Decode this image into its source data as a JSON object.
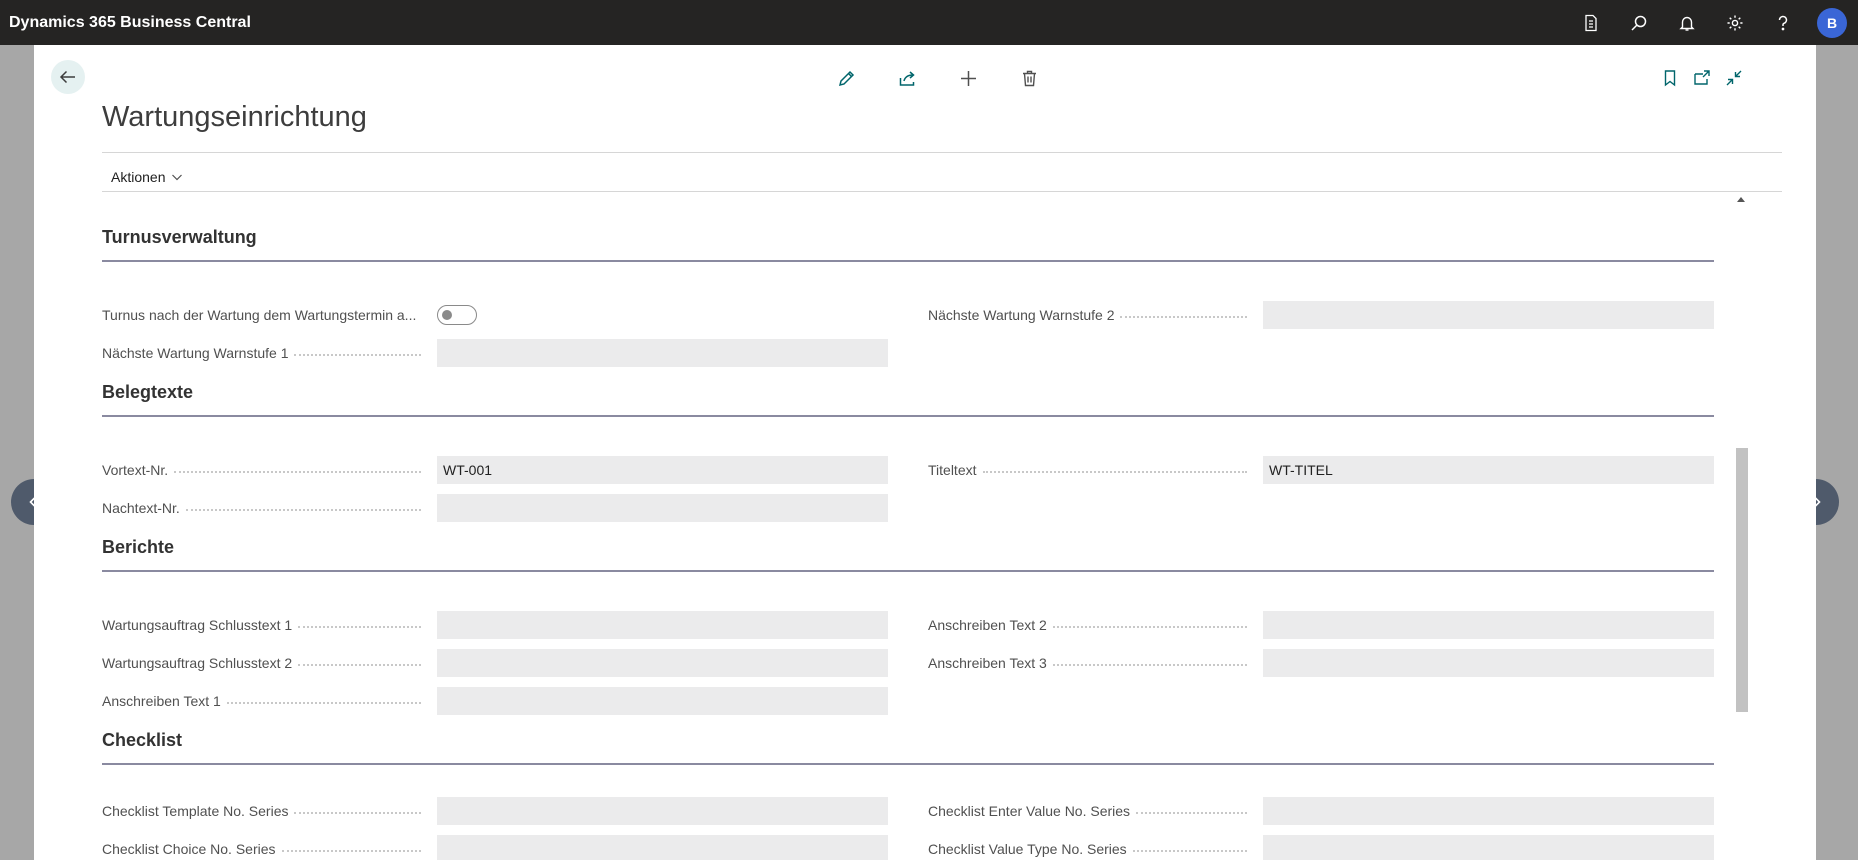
{
  "app": {
    "title": "Dynamics 365 Business Central",
    "user_initial": "B"
  },
  "page": {
    "title": "Wartungseinrichtung",
    "actions_menu_label": "Aktionen"
  },
  "sections": {
    "turnus": {
      "title": "Turnusverwaltung",
      "toggle_label": "Turnus nach der Wartung dem Wartungstermin a...",
      "toggle_on": false,
      "warn1_label": "Nächste Wartung Warnstufe 1",
      "warn1_value": "",
      "warn2_label": "Nächste Wartung Warnstufe 2",
      "warn2_value": ""
    },
    "beleg": {
      "title": "Belegtexte",
      "vortext_label": "Vortext-Nr.",
      "vortext_value": "WT-001",
      "nachtext_label": "Nachtext-Nr.",
      "nachtext_value": "",
      "titel_label": "Titeltext",
      "titel_value": "WT-TITEL"
    },
    "berichte": {
      "title": "Berichte",
      "schluss1_label": "Wartungsauftrag Schlusstext 1",
      "schluss1_value": "",
      "schluss2_label": "Wartungsauftrag Schlusstext 2",
      "schluss2_value": "",
      "ansch1_label": "Anschreiben Text 1",
      "ansch1_value": "",
      "ansch2_label": "Anschreiben Text 2",
      "ansch2_value": "",
      "ansch3_label": "Anschreiben Text 3",
      "ansch3_value": ""
    },
    "checklist": {
      "title": "Checklist",
      "template_label": "Checklist Template No. Series",
      "template_value": "",
      "choice_label": "Checklist Choice No. Series",
      "choice_value": "",
      "enter_label": "Checklist Enter Value No. Series",
      "enter_value": "",
      "valuetype_label": "Checklist Value Type No. Series",
      "valuetype_value": ""
    }
  },
  "icons": {
    "appbar": [
      "document-icon",
      "search-icon",
      "bell-icon",
      "gear-icon",
      "help-icon"
    ],
    "toolbar": [
      "edit-icon",
      "share-icon",
      "add-icon",
      "delete-icon"
    ],
    "toolbar_right": [
      "bookmark-icon",
      "open-new-window-icon",
      "collapse-icon"
    ]
  },
  "colors": {
    "appbar_bg": "#252423",
    "accent": "#00656b",
    "avatar_bg": "#3a66d6",
    "nav_circle": "#4f5a6b"
  }
}
